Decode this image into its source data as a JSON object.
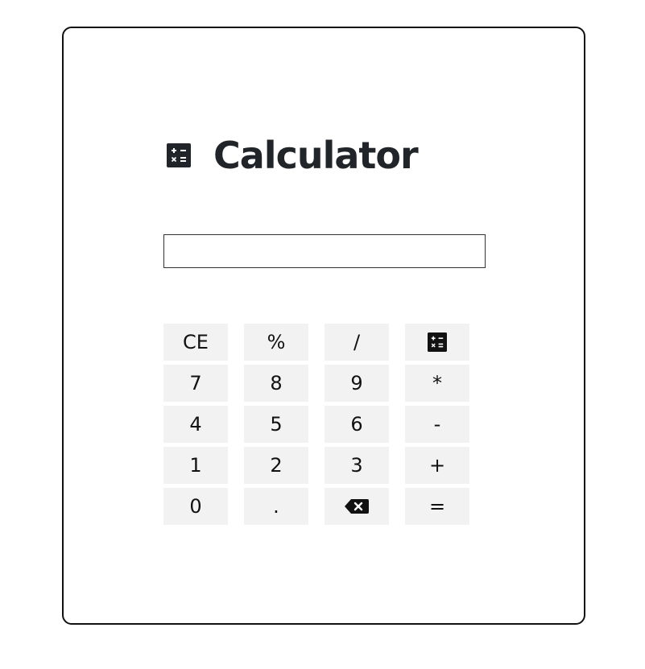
{
  "app": {
    "title": "Calculator",
    "title_icon": "calculator-icon"
  },
  "display": {
    "value": "",
    "placeholder": ""
  },
  "keypad": {
    "rows": [
      [
        {
          "label": "CE",
          "name": "clear-entry-button"
        },
        {
          "label": "%",
          "name": "percent-button"
        },
        {
          "label": "/",
          "name": "divide-button"
        },
        {
          "label": "",
          "icon": "calculator-icon",
          "name": "calculator-mode-button"
        }
      ],
      [
        {
          "label": "7",
          "name": "digit-7-button"
        },
        {
          "label": "8",
          "name": "digit-8-button"
        },
        {
          "label": "9",
          "name": "digit-9-button"
        },
        {
          "label": "*",
          "name": "multiply-button"
        }
      ],
      [
        {
          "label": "4",
          "name": "digit-4-button"
        },
        {
          "label": "5",
          "name": "digit-5-button"
        },
        {
          "label": "6",
          "name": "digit-6-button"
        },
        {
          "label": "-",
          "name": "subtract-button"
        }
      ],
      [
        {
          "label": "1",
          "name": "digit-1-button"
        },
        {
          "label": "2",
          "name": "digit-2-button"
        },
        {
          "label": "3",
          "name": "digit-3-button"
        },
        {
          "label": "+",
          "name": "add-button"
        }
      ],
      [
        {
          "label": "0",
          "name": "digit-0-button"
        },
        {
          "label": ".",
          "name": "decimal-button"
        },
        {
          "label": "",
          "icon": "backspace-icon",
          "name": "backspace-button"
        },
        {
          "label": "=",
          "name": "equals-button"
        }
      ]
    ]
  },
  "colors": {
    "key_background": "#f2f2f2",
    "title_text": "#212529",
    "border": "#111111"
  }
}
